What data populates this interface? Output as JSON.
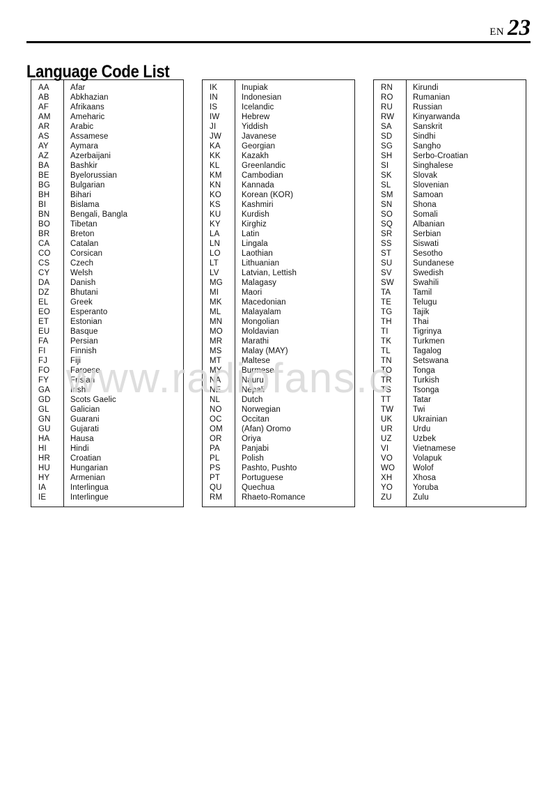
{
  "header": {
    "lang_code": "EN",
    "page_number": "23"
  },
  "title": "Language Code List",
  "watermark": "www.radiofans.c",
  "tables": [
    {
      "id": "language-table-1",
      "rows": [
        {
          "code": "AA",
          "name": "Afar"
        },
        {
          "code": "AB",
          "name": "Abkhazian"
        },
        {
          "code": "AF",
          "name": "Afrikaans"
        },
        {
          "code": "AM",
          "name": "Ameharic"
        },
        {
          "code": "AR",
          "name": "Arabic"
        },
        {
          "code": "AS",
          "name": "Assamese"
        },
        {
          "code": "AY",
          "name": "Aymara"
        },
        {
          "code": "AZ",
          "name": "Azerbaijani"
        },
        {
          "code": "BA",
          "name": "Bashkir"
        },
        {
          "code": "BE",
          "name": "Byelorussian"
        },
        {
          "code": "BG",
          "name": "Bulgarian"
        },
        {
          "code": "BH",
          "name": "Bihari"
        },
        {
          "code": "BI",
          "name": "Bislama"
        },
        {
          "code": "BN",
          "name": "Bengali, Bangla"
        },
        {
          "code": "BO",
          "name": "Tibetan"
        },
        {
          "code": "BR",
          "name": "Breton"
        },
        {
          "code": "CA",
          "name": "Catalan"
        },
        {
          "code": "CO",
          "name": "Corsican"
        },
        {
          "code": "CS",
          "name": "Czech"
        },
        {
          "code": "CY",
          "name": "Welsh"
        },
        {
          "code": "DA",
          "name": "Danish"
        },
        {
          "code": "DZ",
          "name": "Bhutani"
        },
        {
          "code": "EL",
          "name": "Greek"
        },
        {
          "code": "EO",
          "name": "Esperanto"
        },
        {
          "code": "ET",
          "name": "Estonian"
        },
        {
          "code": "EU",
          "name": "Basque"
        },
        {
          "code": "FA",
          "name": "Persian"
        },
        {
          "code": "FI",
          "name": "Finnish"
        },
        {
          "code": "FJ",
          "name": "Fiji"
        },
        {
          "code": "FO",
          "name": "Faroese"
        },
        {
          "code": "FY",
          "name": "Frisian"
        },
        {
          "code": "GA",
          "name": "Irish"
        },
        {
          "code": "GD",
          "name": "Scots Gaelic"
        },
        {
          "code": "GL",
          "name": "Galician"
        },
        {
          "code": "GN",
          "name": "Guarani"
        },
        {
          "code": "GU",
          "name": "Gujarati"
        },
        {
          "code": "HA",
          "name": "Hausa"
        },
        {
          "code": "HI",
          "name": "Hindi"
        },
        {
          "code": "HR",
          "name": "Croatian"
        },
        {
          "code": "HU",
          "name": "Hungarian"
        },
        {
          "code": "HY",
          "name": "Armenian"
        },
        {
          "code": "IA",
          "name": "Interlingua"
        },
        {
          "code": "IE",
          "name": "Interlingue"
        }
      ]
    },
    {
      "id": "language-table-2",
      "rows": [
        {
          "code": "IK",
          "name": "Inupiak"
        },
        {
          "code": "IN",
          "name": "Indonesian"
        },
        {
          "code": "IS",
          "name": "Icelandic"
        },
        {
          "code": "IW",
          "name": "Hebrew"
        },
        {
          "code": "JI",
          "name": "Yiddish"
        },
        {
          "code": "JW",
          "name": "Javanese"
        },
        {
          "code": "KA",
          "name": "Georgian"
        },
        {
          "code": "KK",
          "name": "Kazakh"
        },
        {
          "code": "KL",
          "name": "Greenlandic"
        },
        {
          "code": "KM",
          "name": "Cambodian"
        },
        {
          "code": "KN",
          "name": "Kannada"
        },
        {
          "code": "KO",
          "name": "Korean (KOR)"
        },
        {
          "code": "KS",
          "name": "Kashmiri"
        },
        {
          "code": "KU",
          "name": "Kurdish"
        },
        {
          "code": "KY",
          "name": "Kirghiz"
        },
        {
          "code": "LA",
          "name": "Latin"
        },
        {
          "code": "LN",
          "name": "Lingala"
        },
        {
          "code": "LO",
          "name": "Laothian"
        },
        {
          "code": "LT",
          "name": "Lithuanian"
        },
        {
          "code": "LV",
          "name": "Latvian, Lettish"
        },
        {
          "code": "MG",
          "name": "Malagasy"
        },
        {
          "code": "MI",
          "name": "Maori"
        },
        {
          "code": "MK",
          "name": "Macedonian"
        },
        {
          "code": "ML",
          "name": "Malayalam"
        },
        {
          "code": "MN",
          "name": "Mongolian"
        },
        {
          "code": "MO",
          "name": "Moldavian"
        },
        {
          "code": "MR",
          "name": "Marathi"
        },
        {
          "code": "MS",
          "name": "Malay (MAY)"
        },
        {
          "code": "MT",
          "name": "Maltese"
        },
        {
          "code": "MY",
          "name": "Burmese"
        },
        {
          "code": "NA",
          "name": "Nauru"
        },
        {
          "code": "NE",
          "name": "Nepali"
        },
        {
          "code": "NL",
          "name": "Dutch"
        },
        {
          "code": "NO",
          "name": "Norwegian"
        },
        {
          "code": "OC",
          "name": "Occitan"
        },
        {
          "code": "OM",
          "name": "(Afan) Oromo"
        },
        {
          "code": "OR",
          "name": "Oriya"
        },
        {
          "code": "PA",
          "name": "Panjabi"
        },
        {
          "code": "PL",
          "name": "Polish"
        },
        {
          "code": "PS",
          "name": "Pashto, Pushto"
        },
        {
          "code": "PT",
          "name": "Portuguese"
        },
        {
          "code": "QU",
          "name": "Quechua"
        },
        {
          "code": "RM",
          "name": "Rhaeto-Romance"
        }
      ]
    },
    {
      "id": "language-table-3",
      "rows": [
        {
          "code": "RN",
          "name": "Kirundi"
        },
        {
          "code": "RO",
          "name": "Rumanian"
        },
        {
          "code": "RU",
          "name": "Russian"
        },
        {
          "code": "RW",
          "name": "Kinyarwanda"
        },
        {
          "code": "SA",
          "name": "Sanskrit"
        },
        {
          "code": "SD",
          "name": "Sindhi"
        },
        {
          "code": "SG",
          "name": "Sangho"
        },
        {
          "code": "SH",
          "name": "Serbo-Croatian"
        },
        {
          "code": "SI",
          "name": "Singhalese"
        },
        {
          "code": "SK",
          "name": "Slovak"
        },
        {
          "code": "SL",
          "name": "Slovenian"
        },
        {
          "code": "SM",
          "name": "Samoan"
        },
        {
          "code": "SN",
          "name": "Shona"
        },
        {
          "code": "SO",
          "name": "Somali"
        },
        {
          "code": "SQ",
          "name": "Albanian"
        },
        {
          "code": "SR",
          "name": "Serbian"
        },
        {
          "code": "SS",
          "name": "Siswati"
        },
        {
          "code": "ST",
          "name": "Sesotho"
        },
        {
          "code": "SU",
          "name": "Sundanese"
        },
        {
          "code": "SV",
          "name": "Swedish"
        },
        {
          "code": "SW",
          "name": "Swahili"
        },
        {
          "code": "TA",
          "name": "Tamil"
        },
        {
          "code": "TE",
          "name": "Telugu"
        },
        {
          "code": "TG",
          "name": "Tajik"
        },
        {
          "code": "TH",
          "name": "Thai"
        },
        {
          "code": "TI",
          "name": "Tigrinya"
        },
        {
          "code": "TK",
          "name": "Turkmen"
        },
        {
          "code": "TL",
          "name": "Tagalog"
        },
        {
          "code": "TN",
          "name": "Setswana"
        },
        {
          "code": "TO",
          "name": "Tonga"
        },
        {
          "code": "TR",
          "name": "Turkish"
        },
        {
          "code": "TS",
          "name": "Tsonga"
        },
        {
          "code": "TT",
          "name": "Tatar"
        },
        {
          "code": "TW",
          "name": "Twi"
        },
        {
          "code": "UK",
          "name": "Ukrainian"
        },
        {
          "code": "UR",
          "name": "Urdu"
        },
        {
          "code": "UZ",
          "name": "Uzbek"
        },
        {
          "code": "VI",
          "name": "Vietnamese"
        },
        {
          "code": "VO",
          "name": "Volapuk"
        },
        {
          "code": "WO",
          "name": "Wolof"
        },
        {
          "code": "XH",
          "name": "Xhosa"
        },
        {
          "code": "YO",
          "name": "Yoruba"
        },
        {
          "code": "ZU",
          "name": "Zulu"
        }
      ]
    }
  ]
}
